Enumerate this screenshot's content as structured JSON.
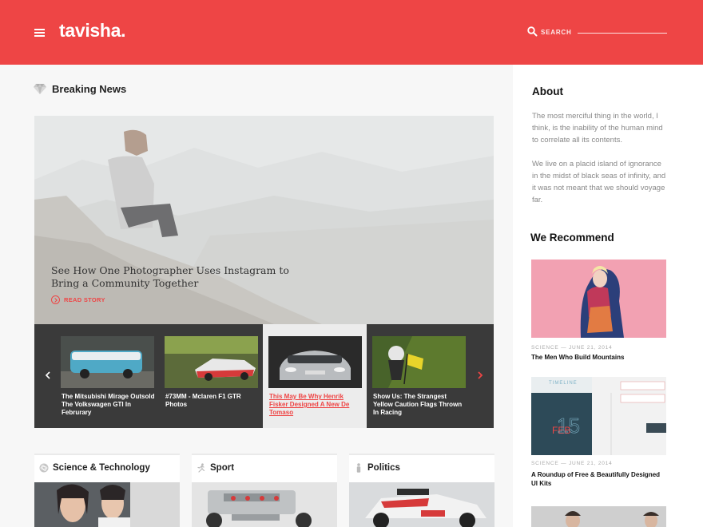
{
  "header": {
    "logo": "tavisha.",
    "search_placeholder": "SEARCH",
    "accent": "#ee4545"
  },
  "breaking": {
    "title": "Breaking News",
    "hero_title": "See How One Photographer Uses Instagram to Bring a Community Together",
    "read_story": "READ STORY"
  },
  "carousel": {
    "items": [
      {
        "caption": "The Mitsubishi Mirage Outsold The Volkswagen GTI In Februrary",
        "active": false
      },
      {
        "caption": "#73MM - Mclaren F1 GTR Photos",
        "active": false
      },
      {
        "caption": "This May Be Why Henrik Fisker Designed A New De Tomaso",
        "active": true
      },
      {
        "caption": "Show Us: The Strangest Yellow Caution Flags Thrown In Racing",
        "active": false
      }
    ]
  },
  "categories": [
    {
      "title": "Science & Technology",
      "icon": "atom-icon"
    },
    {
      "title": "Sport",
      "icon": "runner-icon"
    },
    {
      "title": "Politics",
      "icon": "person-icon"
    }
  ],
  "sidebar": {
    "about_title": "About",
    "about_p1": "The most merciful thing in the world, I think, is the inability of the human mind to correlate all its contents.",
    "about_p2": "We live on a placid island of ignorance in the midst of black seas of infinity, and it was not meant that we should voyage far.",
    "recommend_title": "We Recommend",
    "recommend": [
      {
        "meta": "SCIENCE — JUNE 21, 2014",
        "title": "The Men Who Build Mountains"
      },
      {
        "meta": "SCIENCE — JUNE 21, 2014",
        "title": "A Roundup of Free & Beautifully Designed UI Kits",
        "image_text": {
          "timeline": "TIMELINE",
          "month": "FEB",
          "day": "15"
        }
      }
    ]
  }
}
